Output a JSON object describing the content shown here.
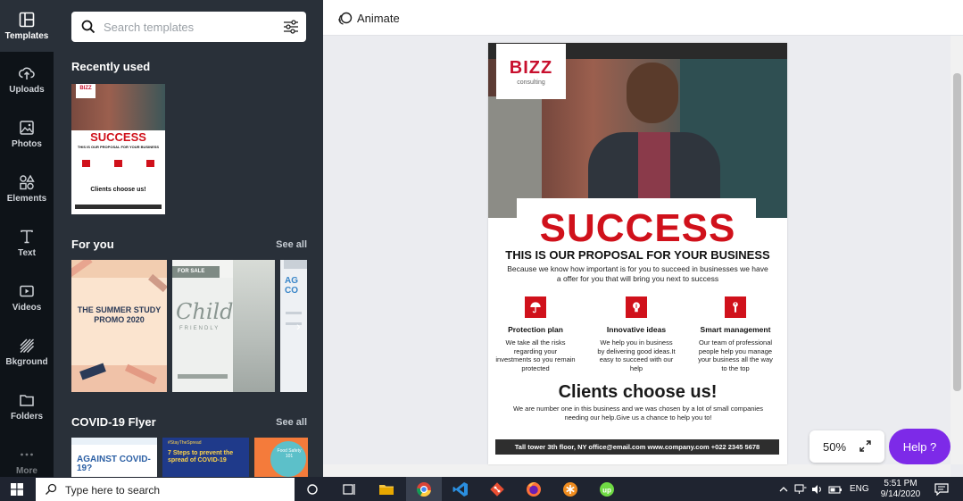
{
  "rail": {
    "items": [
      {
        "label": "Templates",
        "icon": "templates-icon",
        "active": true
      },
      {
        "label": "Uploads",
        "icon": "upload-icon"
      },
      {
        "label": "Photos",
        "icon": "photo-icon"
      },
      {
        "label": "Elements",
        "icon": "shapes-icon"
      },
      {
        "label": "Text",
        "icon": "text-icon"
      },
      {
        "label": "Videos",
        "icon": "video-icon"
      },
      {
        "label": "Bkground",
        "icon": "background-icon"
      },
      {
        "label": "Folders",
        "icon": "folder-icon"
      },
      {
        "label": "More",
        "icon": "more-icon"
      }
    ]
  },
  "panel": {
    "search_placeholder": "Search templates",
    "recently_used_title": "Recently used",
    "for_you_title": "For you",
    "for_you_see_all": "See all",
    "covid_title": "COVID-19 Flyer",
    "covid_see_all": "See all",
    "recent_thumb": {
      "brand": "BIZZ",
      "headline": "SUCCESS",
      "sub": "THIS IS OUR PROPOSAL FOR YOUR BUSINESS",
      "clients": "Clients choose us!"
    },
    "for_you_thumbs": [
      {
        "line1": "THE SUMMER STUDY",
        "line2": "PROMO 2020"
      },
      {
        "tag": "FOR SALE",
        "title": "Child",
        "subtitle": "FRIENDLY"
      },
      {
        "title": "AG CO"
      }
    ],
    "covid_thumbs": [
      {
        "title": "AGAINST COVID-19?"
      },
      {
        "tag": "#StayTheSpread",
        "title": "7 Steps to prevent the spread of COVID-19"
      },
      {
        "title": "Food Safety 101"
      }
    ]
  },
  "editor": {
    "animate_label": "Animate",
    "zoom_label": "50%",
    "help_label": "Help ?"
  },
  "flyer": {
    "brand": "BIZZ",
    "brand_sub": "consulting",
    "headline": "SUCCESS",
    "proposal": "THIS IS OUR PROPOSAL FOR YOUR BUSINESS",
    "intro": "Because we know how important is for you to succeed in businesses we have a offer for you that will bring you next to success",
    "features": [
      {
        "title": "Protection plan",
        "desc": "We take all the risks regarding your investments so you remain protected",
        "icon": "umbrella-icon"
      },
      {
        "title": "Innovative ideas",
        "desc": "We help you in business by delivering good ideas.It easy to succeed with our help",
        "icon": "lightbulb-icon"
      },
      {
        "title": "Smart management",
        "desc": "Our team of professional people help you manage your business all the way to the top",
        "icon": "wrench-icon"
      }
    ],
    "clients_title": "Clients choose us!",
    "clients_desc": "We are number one in this business and we was chosen by a lot of small companies needing our help.Give us a chance to help you to!",
    "footer": "Tall tower 3th floor, NY office@email.com www.company.com +022 2345 5678"
  },
  "taskbar": {
    "search_placeholder": "Type here to search",
    "lang": "ENG",
    "time": "5:51 PM",
    "date": "9/14/2020"
  },
  "colors": {
    "accent": "#7d2ae8",
    "flyer_red": "#d0111b",
    "rail_bg": "#0e1318",
    "panel_bg": "#293039"
  }
}
